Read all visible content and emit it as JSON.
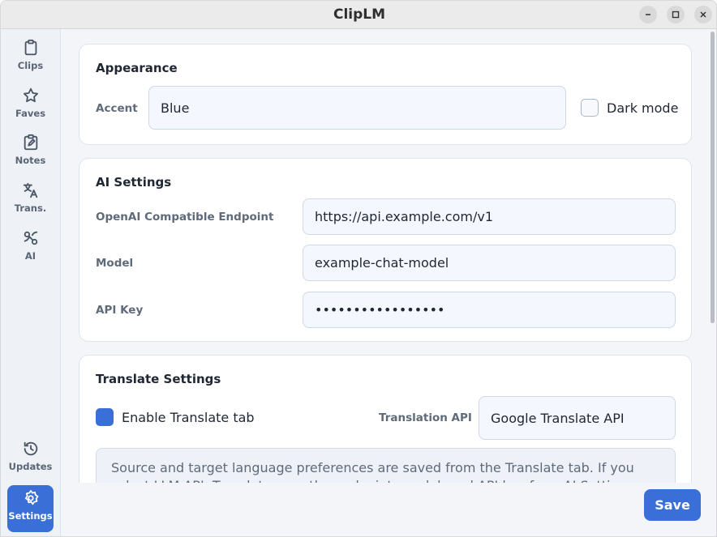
{
  "window": {
    "title": "ClipLM"
  },
  "sidebar": {
    "items": [
      {
        "label": "Clips",
        "icon": "clipboard-icon"
      },
      {
        "label": "Faves",
        "icon": "star-icon"
      },
      {
        "label": "Notes",
        "icon": "note-edit-icon"
      },
      {
        "label": "Trans.",
        "icon": "translate-icon"
      },
      {
        "label": "AI",
        "icon": "ai-icon"
      },
      {
        "label": "Updates",
        "icon": "history-icon"
      },
      {
        "label": "Settings",
        "icon": "gear-icon",
        "active": true
      }
    ]
  },
  "appearance": {
    "title": "Appearance",
    "accent_label": "Accent",
    "accent_value": "Blue",
    "dark_mode_label": "Dark mode",
    "dark_mode_checked": false
  },
  "ai_settings": {
    "title": "AI Settings",
    "endpoint_label": "OpenAI Compatible Endpoint",
    "endpoint_value": "https://api.example.com/v1",
    "model_label": "Model",
    "model_value": "example-chat-model",
    "api_key_label": "API Key",
    "api_key_value": "•••••••••••••••••"
  },
  "translate_settings": {
    "title": "Translate Settings",
    "enable_label": "Enable Translate tab",
    "enable_checked": true,
    "api_label": "Translation API",
    "api_value": "Google Translate API",
    "note": "Source and target language preferences are saved from the Translate tab. If you select LLM API, Translate uses the endpoint, model, and API key from AI Settings."
  },
  "footer": {
    "save_label": "Save"
  },
  "colors": {
    "accent": "#3a6fd8"
  }
}
